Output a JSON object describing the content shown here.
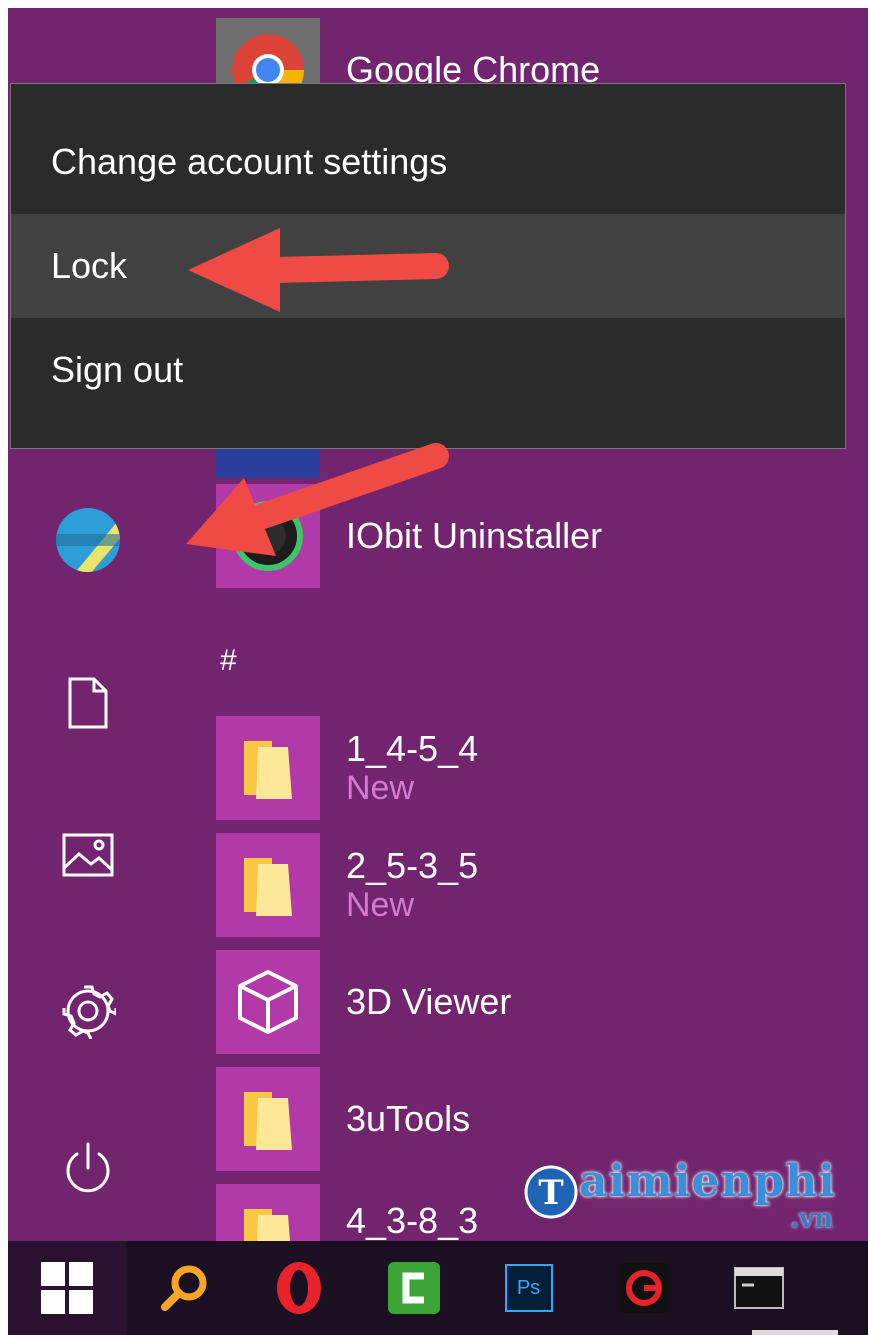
{
  "menu": {
    "items": [
      {
        "label": "Change account settings"
      },
      {
        "label": "Lock"
      },
      {
        "label": "Sign out"
      }
    ]
  },
  "apps": {
    "chrome": {
      "label": "Google Chrome",
      "icon": "chrome-icon"
    },
    "iobit": {
      "label": "IObit Uninstaller",
      "icon": "iobit-icon"
    },
    "section_header": "#",
    "list": [
      {
        "label": "1_4-5_4",
        "sub": "New",
        "icon": "folder-icon"
      },
      {
        "label": "2_5-3_5",
        "sub": "New",
        "icon": "folder-icon"
      },
      {
        "label": "3D Viewer",
        "icon": "cube-icon"
      },
      {
        "label": "3uTools",
        "icon": "folder-icon"
      },
      {
        "label": "4_3-8_3",
        "icon": "folder-icon"
      }
    ]
  },
  "sidebar": {
    "items": [
      "user-avatar-icon",
      "documents-icon",
      "pictures-icon",
      "settings-gear-icon",
      "power-icon"
    ]
  },
  "taskbar": {
    "items": [
      "windows-start-icon",
      "search-magnifier-icon",
      "opera-icon",
      "camtasia-icon",
      "photoshop-icon",
      "garena-icon",
      "command-prompt-icon"
    ],
    "photoshop_label": "Ps"
  },
  "watermark": {
    "main": "aimienphi",
    "suffix": ".vn",
    "logo_letter": "T"
  },
  "colors": {
    "background": "#73246f",
    "tile": "#b23aa8",
    "menu": "#2b2b2b",
    "menu_hover": "#414141",
    "arrow": "#f04a45"
  }
}
